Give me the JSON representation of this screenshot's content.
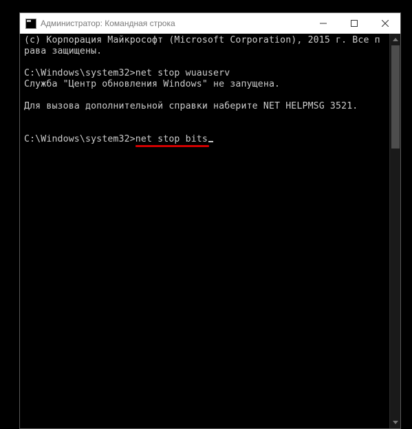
{
  "titlebar": {
    "title": "Администратор: Командная строка"
  },
  "console": {
    "copyright_line1": "(c) Корпорация Майкрософт (Microsoft Corporation), 2015 г. Все права защищены.",
    "blank1": "",
    "prompt1_path": "C:\\Windows\\system32>",
    "prompt1_cmd": "net stop wuauserv",
    "response1": "Служба \"Центр обновления Windows\" не запущена.",
    "blank2": "",
    "help_line": "Для вызова дополнительной справки наберите NET HELPMSG 3521.",
    "blank3": "",
    "blank4": "",
    "prompt2_path": "C:\\Windows\\system32>",
    "prompt2_cmd": "net stop bits"
  },
  "annotation": {
    "underline_color": "#d40000"
  }
}
